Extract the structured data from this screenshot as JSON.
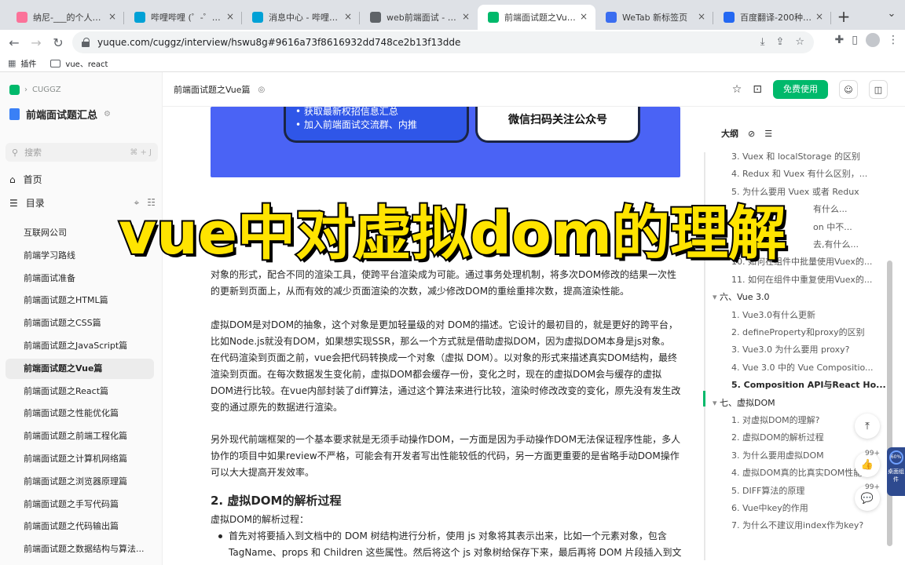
{
  "browser": {
    "tabs": [
      {
        "label": "纳尼-___的个人空间_哔",
        "favicon_color": "#fb7299",
        "active": false
      },
      {
        "label": "哔哩哔哩 (゜-゜)つロ 干",
        "favicon_color": "#00a1d6",
        "active": false
      },
      {
        "label": "消息中心 - 哔哩哔哩弹",
        "favicon_color": "#00a1d6",
        "active": false
      },
      {
        "label": "web前端面试 - 面试官",
        "favicon_color": "#5f6368",
        "active": false
      },
      {
        "label": "前端面试题之Vue篇",
        "favicon_color": "#00b96b",
        "active": true
      },
      {
        "label": "WeTab 新标签页",
        "favicon_color": "#3a6df0",
        "active": false
      },
      {
        "label": "百度翻译-200种语言互",
        "favicon_color": "#2468f2",
        "active": false
      }
    ],
    "new_tab": "+",
    "url": "yuque.com/cuggz/interview/hswu8g#9616a73f8616932dd748ce2b13f13dde",
    "bookmarks": [
      {
        "label": "插件",
        "icon": "grid-icon"
      },
      {
        "label": "vue、react",
        "icon": "folder-icon"
      }
    ]
  },
  "sidebar": {
    "breadcrumb": "CUGGZ",
    "book_title": "前端面试题汇总",
    "search_placeholder": "搜索",
    "search_shortcut": "⌘ + J",
    "home_label": "首页",
    "toc_label": "目录",
    "doc_items": [
      {
        "label": "互联网公司",
        "active": false
      },
      {
        "label": "前端学习路线",
        "active": false
      },
      {
        "label": "前端面试准备",
        "active": false
      },
      {
        "label": "前端面试题之HTML篇",
        "active": false
      },
      {
        "label": "前端面试题之CSS篇",
        "active": false
      },
      {
        "label": "前端面试题之JavaScript篇",
        "active": false
      },
      {
        "label": "前端面试题之Vue篇",
        "active": true
      },
      {
        "label": "前端面试题之React篇",
        "active": false
      },
      {
        "label": "前端面试题之性能优化篇",
        "active": false
      },
      {
        "label": "前端面试题之前端工程化篇",
        "active": false
      },
      {
        "label": "前端面试题之计算机网络篇",
        "active": false
      },
      {
        "label": "前端面试题之浏览器原理篇",
        "active": false
      },
      {
        "label": "前端面试题之手写代码篇",
        "active": false
      },
      {
        "label": "前端面试题之代码输出篇",
        "active": false
      },
      {
        "label": "前端面试题之数据结构与算法...",
        "active": false
      }
    ]
  },
  "doc_header": {
    "title": "前端面试题之Vue篇",
    "free_button": "免费使用"
  },
  "article": {
    "banner": {
      "left_lines": [
        "• 获取最新权招信息汇总",
        "• 加入前端面试交流群、内推"
      ],
      "right_text": "微信扫码关注公众号"
    },
    "paragraphs": [
      "对象的形式，配合不同的渲染工具，使跨平台渲染成为可能。通过事务处理机制，将多次DOM修改的结果一次性的更新到页面上，从而有效的减少页面渲染的次数，减少修改DOM的重绘重排次数，提高渲染性能。",
      "虚拟DOM是对DOM的抽象，这个对象是更加轻量级的对 DOM的描述。它设计的最初目的，就是更好的跨平台，比如Node.js就没有DOM，如果想实现SSR，那么一个方式就是借助虚拟DOM，因为虚拟DOM本身是js对象。 在代码渲染到页面之前，vue会把代码转换成一个对象（虚拟 DOM）。以对象的形式来描述真实DOM结构，最终渲染到页面。在每次数据发生变化前，虚拟DOM都会缓存一份，变化之时，现在的虚拟DOM会与缓存的虚拟DOM进行比较。在vue内部封装了diff算法，通过这个算法来进行比较，渲染时修改改变的变化，原先没有发生改变的通过原先的数据进行渲染。",
      "另外现代前端框架的一个基本要求就是无须手动操作DOM，一方面是因为手动操作DOM无法保证程序性能，多人协作的项目中如果review不严格，可能会有开发者写出性能较低的代码，另一方面更重要的是省略手动DOM操作可以大大提高开发效率。"
    ],
    "heading2": "2. 虚拟DOM的解析过程",
    "subtext": "虚拟DOM的解析过程：",
    "bullet": "首先对将要插入到文档中的 DOM 树结构进行分析，使用 js 对象将其表示出来，比如一个元素对象，包含 TagName、props 和 Children 这些属性。然后将这个 js 对象树给保存下来，最后再将 DOM 片段插入到文"
  },
  "outline": {
    "title": "大纲",
    "items": [
      {
        "label": "3. Vuex 和 localStorage 的区别",
        "type": "item"
      },
      {
        "label": "4. Redux 和 Vuex 有什么区别，...",
        "type": "item"
      },
      {
        "label": "5. 为什么要用 Vuex 或者 Redux",
        "type": "item"
      },
      {
        "label": "有什么...",
        "type": "item"
      },
      {
        "label": "on 中不...",
        "type": "item"
      },
      {
        "label": "去,有什么...",
        "type": "item"
      },
      {
        "label": "10. 如何在组件中批量使用Vuex的...",
        "type": "item"
      },
      {
        "label": "11. 如何在组件中重复使用Vuex的...",
        "type": "item"
      },
      {
        "label": "六、Vue 3.0",
        "type": "section"
      },
      {
        "label": "1. Vue3.0有什么更新",
        "type": "item"
      },
      {
        "label": "2. defineProperty和proxy的区别",
        "type": "item"
      },
      {
        "label": "3. Vue3.0 为什么要用 proxy?",
        "type": "item"
      },
      {
        "label": "4. Vue 3.0 中的 Vue Compositio...",
        "type": "item"
      },
      {
        "label": "5. Composition API与React Ho...",
        "type": "bold"
      },
      {
        "label": "七、虚拟DOM",
        "type": "section"
      },
      {
        "label": "1. 对虚拟DOM的理解?",
        "type": "item"
      },
      {
        "label": "2. 虚拟DOM的解析过程",
        "type": "item"
      },
      {
        "label": "3. 为什么要用虚拟DOM",
        "type": "item"
      },
      {
        "label": "4. 虚拟DOM真的比真实DOM性能...",
        "type": "item"
      },
      {
        "label": "5. DIFF算法的原理",
        "type": "item"
      },
      {
        "label": "6. Vue中key的作用",
        "type": "item"
      },
      {
        "label": "7. 为什么不建议用index作为key?",
        "type": "item"
      }
    ]
  },
  "floating": {
    "like_count": "99+",
    "comment_count": "99+"
  },
  "widget": {
    "percent": "60%",
    "label": "桌面组件"
  },
  "overlay_caption": "vue中对虚拟dom的理解",
  "colors": {
    "brand_green": "#00b96b",
    "banner_blue": "#4a63f5",
    "caption_yellow": "#ffe400"
  }
}
